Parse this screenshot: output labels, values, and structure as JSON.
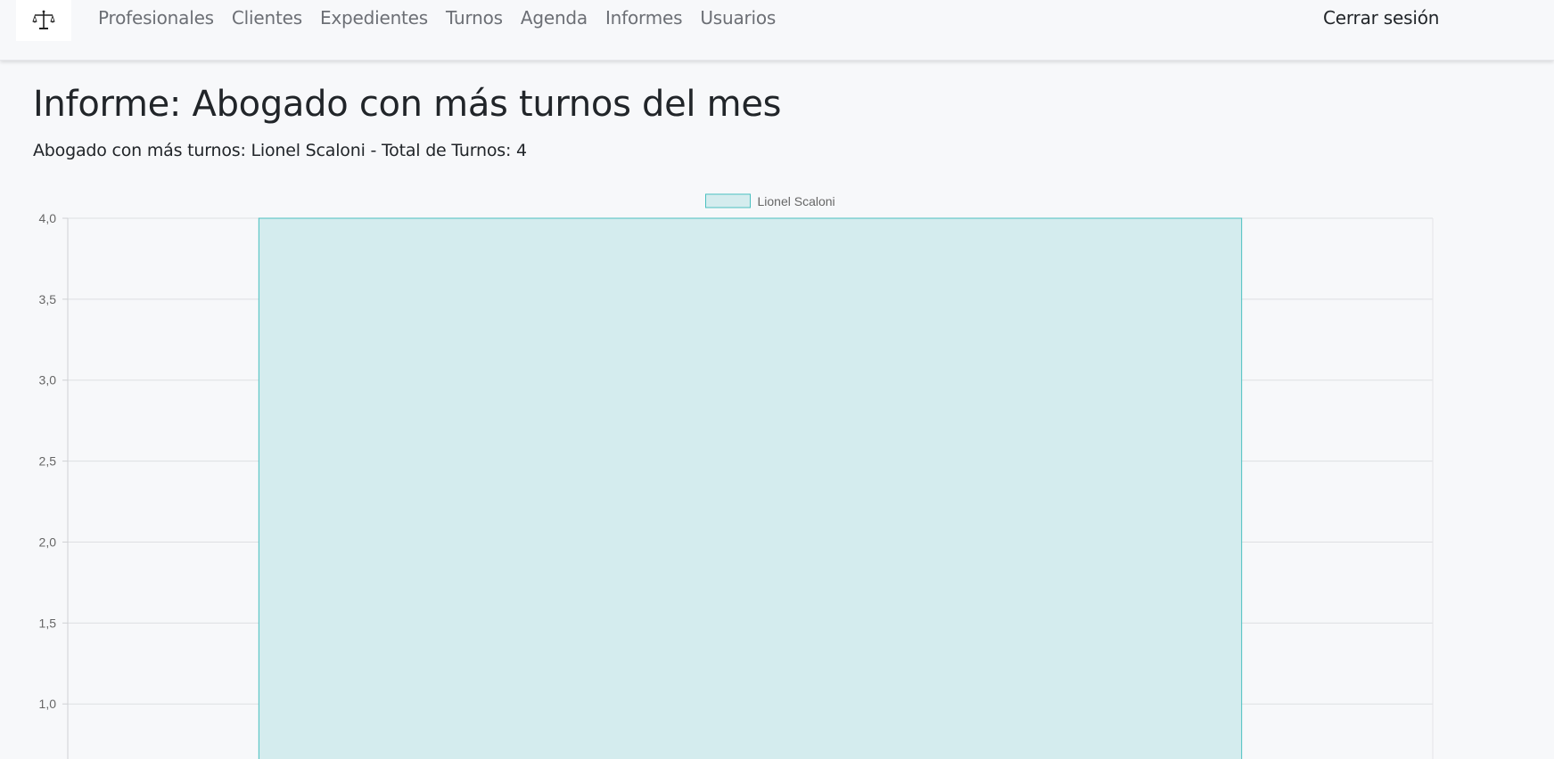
{
  "nav": {
    "items": [
      {
        "label": "Profesionales"
      },
      {
        "label": "Clientes"
      },
      {
        "label": "Expedientes"
      },
      {
        "label": "Turnos"
      },
      {
        "label": "Agenda"
      },
      {
        "label": "Informes"
      },
      {
        "label": "Usuarios"
      }
    ],
    "logout_label": "Cerrar sesión",
    "logo_icon": "scales-icon"
  },
  "page": {
    "title": "Informe: Abogado con más turnos del mes",
    "subtitle": "Abogado con más turnos: Lionel Scaloni - Total de Turnos: 4"
  },
  "chart_data": {
    "type": "bar",
    "categories": [
      ""
    ],
    "series": [
      {
        "name": "Lionel Scaloni",
        "values": [
          4
        ],
        "fill": "#d4ecee",
        "stroke": "#4bc0c0"
      }
    ],
    "y_ticks": [
      "4,0",
      "3,5",
      "3,0",
      "2,5",
      "2,0",
      "1,5",
      "1,0"
    ],
    "ylim": [
      0.66,
      4
    ],
    "grid": true,
    "legend_position": "top"
  }
}
